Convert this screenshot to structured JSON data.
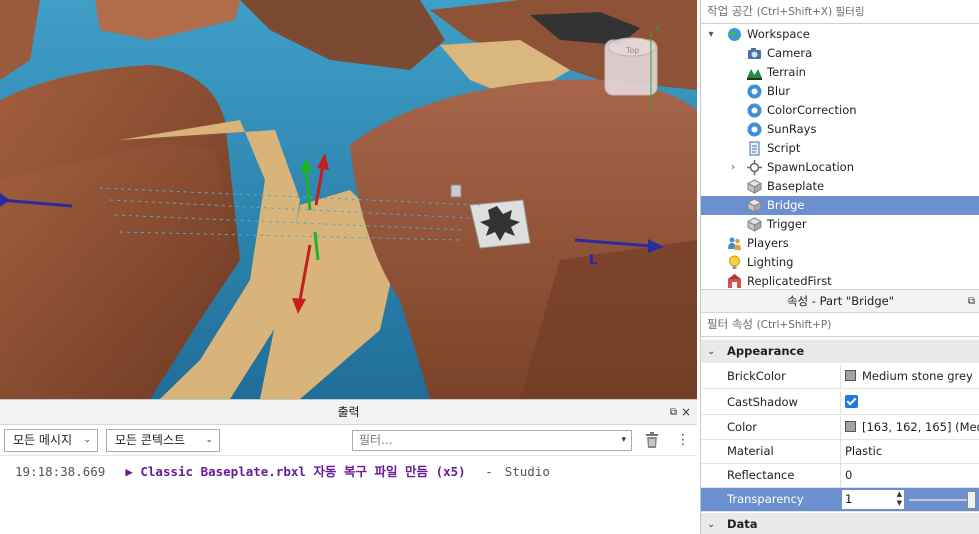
{
  "output": {
    "title": "출력",
    "message_filter": "모든 메시지",
    "context_filter": "모든 콘텍스트",
    "search_placeholder": "필터...",
    "log": [
      {
        "time": "19:18:38.669",
        "message": "Classic Baseplate.rbxl 자동 복구 파일 만듬 (x5)",
        "separator": "-",
        "source": "Studio"
      }
    ]
  },
  "explorer": {
    "filter_placeholder": "작업 공간",
    "filter_hint": "(Ctrl+Shift+X) 필터링",
    "items": [
      {
        "label": "Workspace",
        "icon": "workspace-globe-icon",
        "expander": "▾"
      },
      {
        "label": "Camera",
        "icon": "camera-icon"
      },
      {
        "label": "Terrain",
        "icon": "terrain-icon"
      },
      {
        "label": "Blur",
        "icon": "post-effect-icon"
      },
      {
        "label": "ColorCorrection",
        "icon": "post-effect-icon"
      },
      {
        "label": "SunRays",
        "icon": "post-effect-icon"
      },
      {
        "label": "Script",
        "icon": "script-icon"
      },
      {
        "label": "SpawnLocation",
        "icon": "spawn-location-icon",
        "expander": "›"
      },
      {
        "label": "Baseplate",
        "icon": "part-icon"
      },
      {
        "label": "Bridge",
        "icon": "part-icon",
        "selected": true
      },
      {
        "label": "Trigger",
        "icon": "part-icon"
      },
      {
        "label": "Players",
        "icon": "players-icon"
      },
      {
        "label": "Lighting",
        "icon": "lightbulb-icon"
      },
      {
        "label": "ReplicatedFirst",
        "icon": "replicated-first-icon"
      }
    ]
  },
  "properties": {
    "title": "속성 - Part \"Bridge\"",
    "filter_placeholder": "필터 속성",
    "filter_hint": "(Ctrl+Shift+P)",
    "categories": {
      "appearance": "Appearance",
      "data": "Data"
    },
    "rows": [
      {
        "key": "BrickColor",
        "value": "Medium stone grey"
      },
      {
        "key": "CastShadow",
        "value": "checked"
      },
      {
        "key": "Color",
        "value": "[163, 162, 165] (Med..."
      },
      {
        "key": "Material",
        "value": "Plastic"
      },
      {
        "key": "Reflectance",
        "value": "0"
      },
      {
        "key": "Transparency",
        "value": "1"
      }
    ],
    "color_swatch": "#a3a2a5",
    "transparency_slider": 1
  },
  "viewport": {
    "gizmo_y_label": "Y",
    "gizmo_local_label": "L",
    "viewcube_label": "Top"
  }
}
